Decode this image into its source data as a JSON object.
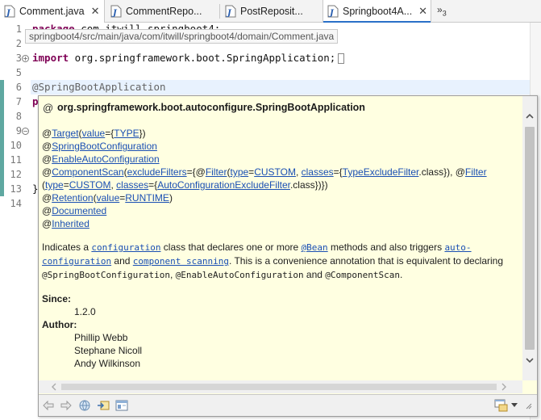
{
  "tabs": [
    {
      "label": "Comment.java",
      "close": "✕",
      "active": true
    },
    {
      "label": "CommentRepo..."
    },
    {
      "label": "PostReposit..."
    },
    {
      "label": "Springboot4A...",
      "close": "✕"
    }
  ],
  "overflow": {
    "symbol": "»",
    "count": "3"
  },
  "editor": {
    "path_tooltip": "springboot4/src/main/java/com/itwill/springboot4/domain/Comment.java",
    "line_numbers": [
      "1",
      "2",
      "3",
      "5",
      "6",
      "7",
      "8",
      "9",
      "10",
      "11",
      "12",
      "13",
      "14"
    ],
    "fold_marks": [
      "+",
      "−"
    ],
    "lines": {
      "l1_kw": "package",
      "l1_rest": " com.itwill.springboot4;",
      "l3_kw": "import",
      "l3_rest": " org.springframework.boot.SpringApplication;",
      "l6": "@SpringBootApplication",
      "l7": "p",
      "l13": "}"
    }
  },
  "hover": {
    "at_icon": "@",
    "title": "org.springframework.boot.autoconfigure.SpringBootApplication",
    "a1": {
      "at": "@",
      "name": "Target",
      "p1": "(",
      "k": "value",
      "eq": "={",
      "v": "TYPE",
      "close": "})"
    },
    "a2": {
      "at": "@",
      "name": "SpringBootConfiguration"
    },
    "a3": {
      "at": "@",
      "name": "EnableAutoConfiguration"
    },
    "a4": {
      "at": "@",
      "name": "ComponentScan",
      "p1": "(",
      "k1": "excludeFilters",
      "eq1": "={@",
      "f1": "Filter",
      "p2": "(",
      "type1": "type",
      "eq2": "=",
      "custom1": "CUSTOM",
      "c1": ", ",
      "classes1": "classes",
      "eq3": "={",
      "tef": "TypeExcludeFilter",
      "tail1": ".class}), @",
      "f2": "Filter"
    },
    "a4b": {
      "p3": "(",
      "type2": "type",
      "eq4": "=",
      "custom2": "CUSTOM",
      "c2": ", ",
      "classes2": "classes",
      "eq5": "={",
      "acef": "AutoConfigurationExcludeFilter",
      "tail2": ".class})})"
    },
    "a5": {
      "at": "@",
      "name": "Retention",
      "p1": "(",
      "k": "value",
      "eq": "=",
      "v": "RUNTIME",
      "close": ")"
    },
    "a6": {
      "at": "@",
      "name": "Documented"
    },
    "a7": {
      "at": "@",
      "name": "Inherited"
    },
    "desc": {
      "t1": "Indicates a ",
      "link1": "configuration",
      "t2": " class that declares one or more ",
      "link2": "@Bean",
      "t3": " methods and also triggers ",
      "link3": "auto-configuration",
      "t4": " and ",
      "link4": "component scanning",
      "t5": ". This is a convenience annotation that is equivalent to declaring ",
      "code1": "@SpringBootConfiguration",
      "t6": ", ",
      "code2": "@EnableAutoConfiguration",
      "t7": " and ",
      "code3": "@ComponentScan",
      "t8": "."
    },
    "since_label": "Since:",
    "since_value": "1.2.0",
    "author_label": "Author:",
    "authors": [
      "Phillip Webb",
      "Stephane Nicoll",
      "Andy Wilkinson"
    ]
  }
}
